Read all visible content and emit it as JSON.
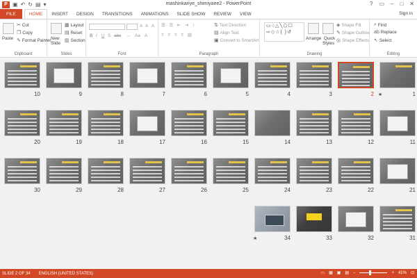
{
  "window": {
    "title": "mashinkariye_shimiyaee2 - PowerPoint",
    "controls": [
      "?",
      "▭",
      "–",
      "□",
      "✕"
    ]
  },
  "ribbon": {
    "tabs": [
      "FILE",
      "HOME",
      "INSERT",
      "DESIGN",
      "TRANSITIONS",
      "ANIMATIONS",
      "SLIDE SHOW",
      "REVIEW",
      "VIEW"
    ],
    "active_tab": "HOME",
    "sign_in": "Sign in",
    "groups": {
      "clipboard": {
        "label": "Clipboard",
        "paste": "Paste",
        "cut": "Cut",
        "copy": "Copy",
        "format_painter": "Format Painter"
      },
      "slides": {
        "label": "Slides",
        "new_slide_1": "New",
        "new_slide_2": "Slide",
        "layout": "Layout",
        "reset": "Reset",
        "section": "Section"
      },
      "font": {
        "label": "Font",
        "font_name": "",
        "font_size": "",
        "bold": "B",
        "italic": "I",
        "underline": "U",
        "shadow": "S",
        "strike": "abc",
        "grow": "A",
        "shrink": "A",
        "clear": "A"
      },
      "paragraph": {
        "label": "Paragraph",
        "text_direction": "Text Direction",
        "align_text": "Align Text",
        "convert_smartart": "Convert to SmartArt"
      },
      "drawing": {
        "label": "Drawing",
        "arrange": "Arrange",
        "quick_styles_1": "Quick",
        "quick_styles_2": "Styles",
        "shape_fill": "Shape Fill",
        "shape_outline": "Shape Outline",
        "shape_effects": "Shape Effects"
      },
      "editing": {
        "label": "Editing",
        "find": "Find",
        "replace": "Replace",
        "select": "Select"
      }
    }
  },
  "slides": [
    {
      "num": "1",
      "kind": "title"
    },
    {
      "num": "2",
      "kind": "text",
      "selected": true
    },
    {
      "num": "3",
      "kind": "text"
    },
    {
      "num": "4",
      "kind": "text"
    },
    {
      "num": "5",
      "kind": "insert"
    },
    {
      "num": "6",
      "kind": "text"
    },
    {
      "num": "7",
      "kind": "insert"
    },
    {
      "num": "8",
      "kind": "text"
    },
    {
      "num": "9",
      "kind": "insert"
    },
    {
      "num": "10",
      "kind": "text"
    },
    {
      "num": "11",
      "kind": "insert"
    },
    {
      "num": "12",
      "kind": "text"
    },
    {
      "num": "13",
      "kind": "text"
    },
    {
      "num": "14",
      "kind": "plain"
    },
    {
      "num": "15",
      "kind": "text"
    },
    {
      "num": "16",
      "kind": "text"
    },
    {
      "num": "17",
      "kind": "insert"
    },
    {
      "num": "18",
      "kind": "text"
    },
    {
      "num": "19",
      "kind": "text"
    },
    {
      "num": "20",
      "kind": "text"
    },
    {
      "num": "21",
      "kind": "insert"
    },
    {
      "num": "22",
      "kind": "text"
    },
    {
      "num": "23",
      "kind": "text"
    },
    {
      "num": "24",
      "kind": "text"
    },
    {
      "num": "25",
      "kind": "text"
    },
    {
      "num": "26",
      "kind": "text"
    },
    {
      "num": "27",
      "kind": "text"
    },
    {
      "num": "28",
      "kind": "text"
    },
    {
      "num": "29",
      "kind": "text"
    },
    {
      "num": "30",
      "kind": "text"
    },
    {
      "num": "31",
      "kind": "text"
    },
    {
      "num": "32",
      "kind": "insert"
    },
    {
      "num": "33",
      "kind": "end"
    },
    {
      "num": "34",
      "kind": "photo"
    }
  ],
  "status": {
    "slide_info": "SLIDE 2 OF 34",
    "language": "ENGLISH (UNITED STATES)",
    "zoom": "41%"
  }
}
